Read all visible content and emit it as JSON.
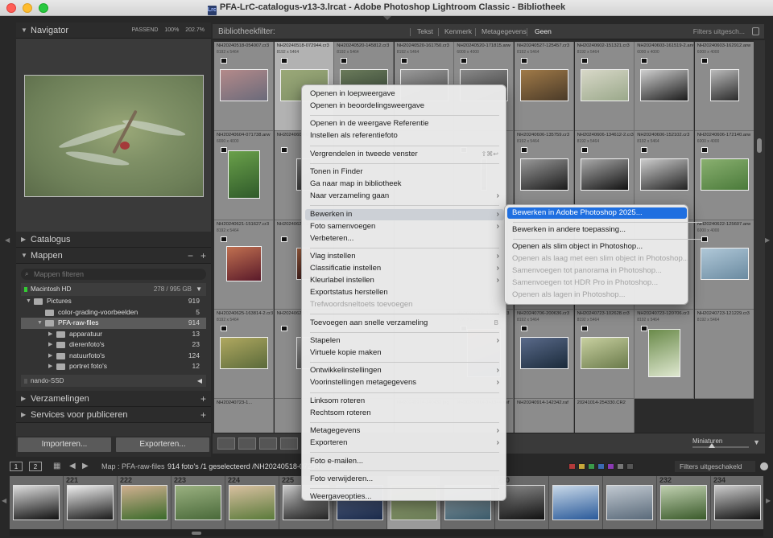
{
  "window": {
    "title": "PFA-LrC-catalogus-v13-3.lrcat - Adobe Photoshop Lightroom Classic - Bibliotheek",
    "doc_icon": "Lrc"
  },
  "navigator": {
    "title": "Navigator",
    "zoom_options": [
      "PASSEND",
      "100%",
      "202.7%"
    ]
  },
  "panels": {
    "catalogus": "Catalogus",
    "mappen": "Mappen",
    "search_placeholder": "Mappen filteren",
    "volume": {
      "name": "Macintosh HD",
      "size": "278 / 995 GB"
    },
    "folders": [
      {
        "name": "Pictures",
        "count": "919",
        "level": 0
      },
      {
        "name": "color-grading-voorbeelden",
        "count": "5",
        "level": 1
      },
      {
        "name": "PFA-raw-files",
        "count": "914",
        "level": 1,
        "selected": true
      },
      {
        "name": "apparatuur",
        "count": "13",
        "level": 2
      },
      {
        "name": "dierenfoto's",
        "count": "23",
        "level": 2
      },
      {
        "name": "natuurfoto's",
        "count": "124",
        "level": 2
      },
      {
        "name": "portret foto's",
        "count": "12",
        "level": 2
      }
    ],
    "drive2": "nando-SSD",
    "verzamelingen": "Verzamelingen",
    "services": "Services voor publiceren"
  },
  "buttons": {
    "import": "Importeren...",
    "export": "Exporteren..."
  },
  "filter_bar": {
    "title": "Bibliotheekfilter:",
    "tabs": [
      "Tekst",
      "Kenmerk",
      "Metagegevens",
      "Geen"
    ],
    "active": "Geen",
    "presets": "Filters uitgesch..."
  },
  "grid": {
    "cells": [
      {
        "name": "NH20240518-054007.cr3",
        "dim": "8192 x 5464",
        "thumb": [
          "#6a6a7a",
          "#b48a8a"
        ],
        "tw": 60,
        "th": 40
      },
      {
        "name": "NH20240518-072944.cr3",
        "dim": "8192 x 5464",
        "thumb": [
          "#7f9066",
          "#9aa878"
        ],
        "tw": 60,
        "th": 40,
        "selected": true
      },
      {
        "name": "NH20240520-145812.cr3",
        "dim": "8192 x 5464",
        "thumb": [
          "#3a4a3a",
          "#6a7a5a"
        ],
        "tw": 60,
        "th": 40
      },
      {
        "name": "NH20240520-161750.cr3",
        "dim": "8192 x 5464",
        "thumb": [
          "#555",
          "#999"
        ],
        "tw": 60,
        "th": 40
      },
      {
        "name": "NH20240520-171815.arw",
        "dim": "6000 x 4000",
        "thumb": [
          "#444",
          "#888"
        ],
        "tw": 60,
        "th": 40
      },
      {
        "name": "NH20240527-125457.cr3",
        "dim": "8192 x 5464",
        "thumb": [
          "#4a3a28",
          "#a07a48"
        ],
        "tw": 60,
        "th": 40
      },
      {
        "name": "NH20240602-151321.cr3",
        "dim": "8192 x 5464",
        "thumb": [
          "#9aa88a",
          "#d8d8c8"
        ],
        "tw": 60,
        "th": 40
      },
      {
        "name": "NH20240603-161519-2.arw",
        "dim": "6000 x 4000",
        "thumb": [
          "#1a1a1a",
          "#cfcfcf"
        ],
        "tw": 60,
        "th": 40
      },
      {
        "name": "NH20240603-162912.arw",
        "dim": "6000 x 4000",
        "thumb": [
          "#2a2a2a",
          "#bbbbbb"
        ],
        "tw": 36,
        "th": 40
      },
      {
        "name": "NH20240604-071738.arw",
        "dim": "6000 x 4000",
        "thumb": [
          "#2f5a2a",
          "#6aa04a"
        ],
        "tw": 40,
        "th": 60
      },
      {
        "name": "NH20240604-0...",
        "dim": "",
        "thumb": [
          "#333",
          "#777"
        ],
        "tw": 20,
        "th": 40
      },
      {
        "name": "",
        "dim": "",
        "thumb": [
          "#333",
          "#666"
        ],
        "tw": 1,
        "th": 1
      },
      {
        "name": "",
        "dim": "",
        "thumb": [
          "#333",
          "#666"
        ],
        "tw": 1,
        "th": 1
      },
      {
        "name": "",
        "dim": "",
        "thumb": [
          "#333",
          "#666"
        ],
        "tw": 8,
        "th": 40
      },
      {
        "name": "NH20240606-135759.cr3",
        "dim": "8192 x 5464",
        "thumb": [
          "#1a1a1a",
          "#999"
        ],
        "tw": 60,
        "th": 40
      },
      {
        "name": "NH20240606-134612-2.cr3",
        "dim": "8192 x 5464",
        "thumb": [
          "#111",
          "#aaa"
        ],
        "tw": 60,
        "th": 40
      },
      {
        "name": "NH20240606-152102.cr3",
        "dim": "8192 x 5464",
        "thumb": [
          "#222",
          "#ccc"
        ],
        "tw": 60,
        "th": 40
      },
      {
        "name": "NH20240606-172140.arw",
        "dim": "6000 x 4000",
        "thumb": [
          "#4a7a3a",
          "#8ab070"
        ],
        "tw": 60,
        "th": 40
      },
      {
        "name": "NH20240621-151627.cr3",
        "dim": "8192 x 5464",
        "thumb": [
          "#5a1a2a",
          "#c07050"
        ],
        "tw": 44,
        "th": 44
      },
      {
        "name": "NH20240621-1...",
        "dim": "",
        "thumb": [
          "#3a1a1a",
          "#a06040"
        ],
        "tw": 20,
        "th": 40
      },
      {
        "name": "",
        "dim": "",
        "thumb": [
          "#333",
          "#666"
        ],
        "tw": 1,
        "th": 1
      },
      {
        "name": "",
        "dim": "",
        "thumb": [
          "#333",
          "#666"
        ],
        "tw": 1,
        "th": 1
      },
      {
        "name": "",
        "dim": "",
        "thumb": [
          "#333",
          "#666"
        ],
        "tw": 1,
        "th": 1
      },
      {
        "name": "",
        "dim": "",
        "thumb": [
          "#333",
          "#666"
        ],
        "tw": 1,
        "th": 1
      },
      {
        "name": "",
        "dim": "",
        "thumb": [
          "#333",
          "#666"
        ],
        "tw": 1,
        "th": 1
      },
      {
        "name": "",
        "dim": "",
        "thumb": [
          "#333",
          "#666"
        ],
        "tw": 1,
        "th": 1
      },
      {
        "name": "NH20240622-125607.arw",
        "dim": "6000 x 4000",
        "thumb": [
          "#6a8aa0",
          "#b0c8d8"
        ],
        "tw": 60,
        "th": 40
      },
      {
        "name": "NH20240625-163814-2.cr3",
        "dim": "8192 x 5464",
        "thumb": [
          "#5a6a3a",
          "#b0a860"
        ],
        "tw": 60,
        "th": 40
      },
      {
        "name": "NH20240625-1...",
        "dim": "",
        "thumb": [
          "#555",
          "#999"
        ],
        "tw": 20,
        "th": 40
      },
      {
        "name": "",
        "dim": "",
        "thumb": [
          "#333",
          "#666"
        ],
        "tw": 1,
        "th": 1
      },
      {
        "name": "",
        "dim": "",
        "thumb": [
          "#333",
          "#666"
        ],
        "tw": 1,
        "th": 1
      },
      {
        "name": "NH20240706-192809.cr3",
        "dim": "8192 x 5464",
        "thumb": [
          "#3a5a7a",
          "#c09070"
        ],
        "tw": 42,
        "th": 60
      },
      {
        "name": "NH20240706-200636.cr3",
        "dim": "8192 x 5464",
        "thumb": [
          "#1a2a3a",
          "#5a6a8a"
        ],
        "tw": 60,
        "th": 40
      },
      {
        "name": "NH20240723-102628.cr3",
        "dim": "8192 x 5464",
        "thumb": [
          "#6a7a4a",
          "#c8d0a0"
        ],
        "tw": 60,
        "th": 40
      },
      {
        "name": "NH20240723-120706.cr3",
        "dim": "8192 x 5464",
        "thumb": [
          "#dfe8d0",
          "#6a8a4a"
        ],
        "tw": 40,
        "th": 60
      },
      {
        "name": "NH20240723-121229.cr3",
        "dim": "8192 x 5464",
        "thumb": [
          "#555",
          "#888"
        ],
        "tw": 1,
        "th": 1
      },
      {
        "name": "NH20240723-1...",
        "dim": "",
        "thumb": [
          "#555",
          "#888"
        ],
        "tw": 1,
        "th": 1
      },
      {
        "name": "",
        "dim": "",
        "thumb": [
          "#333",
          "#666"
        ],
        "tw": 1,
        "th": 1
      },
      {
        "name": "",
        "dim": "",
        "thumb": [
          "#333",
          "#666"
        ],
        "tw": 1,
        "th": 1
      },
      {
        "name": "NH20240914-140432.jpg",
        "dim": "",
        "thumb": [
          "#555",
          "#888"
        ],
        "tw": 1,
        "th": 1
      },
      {
        "name": "NH20240914-141344.nef",
        "dim": "",
        "thumb": [
          "#555",
          "#888"
        ],
        "tw": 1,
        "th": 1
      },
      {
        "name": "NH20240914-142342.raf",
        "dim": "",
        "thumb": [
          "#555",
          "#888"
        ],
        "tw": 1,
        "th": 1
      },
      {
        "name": "20241014-254330.CR2",
        "dim": "",
        "thumb": [
          "#555",
          "#888"
        ],
        "tw": 1,
        "th": 1
      }
    ]
  },
  "toolbar": {
    "thumbnails_label": "Miniaturen"
  },
  "film_header": {
    "num1": "1",
    "num2": "2",
    "path": "Map : PFA-raw-files",
    "count": "914 foto's /1 geselecteerd /NH20240518-07294",
    "filter": "Filters uitgeschakeld",
    "colors": [
      "#b23a3a",
      "#c8a83a",
      "#3a9a4a",
      "#3a6ab2",
      "#8a3ab2",
      "#777777",
      "#555555"
    ]
  },
  "filmstrip": [
    {
      "num": "",
      "thumb": [
        "#111",
        "#ddd"
      ]
    },
    {
      "num": "221",
      "thumb": [
        "#1a1a1a",
        "#eeeeee"
      ]
    },
    {
      "num": "222",
      "thumb": [
        "#3a6a2a",
        "#d0b090"
      ]
    },
    {
      "num": "223",
      "thumb": [
        "#4a6a3a",
        "#9ab080"
      ]
    },
    {
      "num": "224",
      "thumb": [
        "#5a7a3a",
        "#d8c0a0"
      ]
    },
    {
      "num": "225",
      "thumb": [
        "#222",
        "#cccccc"
      ]
    },
    {
      "num": "",
      "thumb": [
        "#1a2a4a",
        "#6a7aa0"
      ]
    },
    {
      "num": "",
      "thumb": [
        "#6d7f58",
        "#9aa878"
      ]
    },
    {
      "num": "",
      "thumb": [
        "#3a5a6a",
        "#b0c0c8"
      ]
    },
    {
      "num": "230",
      "thumb": [
        "#111",
        "#888"
      ]
    },
    {
      "num": "",
      "thumb": [
        "#2a5a9a",
        "#c8d8e8"
      ]
    },
    {
      "num": "",
      "thumb": [
        "#5a6a7a",
        "#c0c8d0"
      ]
    },
    {
      "num": "232",
      "thumb": [
        "#3a5a2a",
        "#c0d0b0"
      ]
    },
    {
      "num": "234",
      "thumb": [
        "#111",
        "#ccc"
      ]
    }
  ],
  "context_menu": [
    {
      "label": "Openen in loepweergave",
      "type": "item"
    },
    {
      "label": "Openen in beoordelingsweergave",
      "type": "item"
    },
    {
      "type": "sep"
    },
    {
      "label": "Openen in de weergave Referentie",
      "type": "item"
    },
    {
      "label": "Instellen als referentiefoto",
      "type": "item"
    },
    {
      "type": "sep"
    },
    {
      "label": "Vergrendelen in tweede venster",
      "type": "item",
      "shortcut": "⇧⌘↩"
    },
    {
      "type": "sep"
    },
    {
      "label": "Tonen in Finder",
      "type": "item"
    },
    {
      "label": "Ga naar map in bibliotheek",
      "type": "item"
    },
    {
      "label": "Naar verzameling gaan",
      "type": "item",
      "submenu": true
    },
    {
      "type": "sep"
    },
    {
      "label": "Bewerken in",
      "type": "item",
      "submenu": true,
      "highlight": true
    },
    {
      "label": "Foto samenvoegen",
      "type": "item",
      "submenu": true
    },
    {
      "label": "Verbeteren...",
      "type": "item"
    },
    {
      "type": "sep"
    },
    {
      "label": "Vlag instellen",
      "type": "item",
      "submenu": true
    },
    {
      "label": "Classificatie instellen",
      "type": "item",
      "submenu": true
    },
    {
      "label": "Kleurlabel instellen",
      "type": "item",
      "submenu": true
    },
    {
      "label": "Exportstatus herstellen",
      "type": "item"
    },
    {
      "label": "Trefwoordsneltoets toevoegen",
      "type": "item",
      "disabled": true
    },
    {
      "type": "sep"
    },
    {
      "label": "Toevoegen aan snelle verzameling",
      "type": "item",
      "shortcut": "B"
    },
    {
      "type": "sep"
    },
    {
      "label": "Stapelen",
      "type": "item",
      "submenu": true
    },
    {
      "label": "Virtuele kopie maken",
      "type": "item"
    },
    {
      "type": "sep"
    },
    {
      "label": "Ontwikkelinstellingen",
      "type": "item",
      "submenu": true
    },
    {
      "label": "Voorinstellingen metagegevens",
      "type": "item",
      "submenu": true
    },
    {
      "type": "sep"
    },
    {
      "label": "Linksom roteren",
      "type": "item"
    },
    {
      "label": "Rechtsom roteren",
      "type": "item"
    },
    {
      "type": "sep"
    },
    {
      "label": "Metagegevens",
      "type": "item",
      "submenu": true
    },
    {
      "label": "Exporteren",
      "type": "item",
      "submenu": true
    },
    {
      "type": "sep"
    },
    {
      "label": "Foto e-mailen...",
      "type": "item"
    },
    {
      "type": "sep"
    },
    {
      "label": "Foto verwijderen...",
      "type": "item"
    },
    {
      "type": "sep"
    },
    {
      "label": "Weergaveopties...",
      "type": "item"
    }
  ],
  "submenu": [
    {
      "label": "Bewerken in Adobe Photoshop 2025...",
      "type": "item",
      "active": true
    },
    {
      "type": "sep"
    },
    {
      "label": "Bewerken in andere toepassing...",
      "type": "item"
    },
    {
      "type": "sep"
    },
    {
      "label": "Openen als slim object in Photoshop...",
      "type": "item"
    },
    {
      "label": "Openen als laag met een slim object in Photoshop...",
      "type": "item",
      "disabled": true
    },
    {
      "label": "Samenvoegen tot panorama in Photoshop...",
      "type": "item",
      "disabled": true
    },
    {
      "label": "Samenvoegen tot HDR Pro in Photoshop...",
      "type": "item",
      "disabled": true
    },
    {
      "label": "Openen als lagen in Photoshop...",
      "type": "item",
      "disabled": true
    }
  ]
}
